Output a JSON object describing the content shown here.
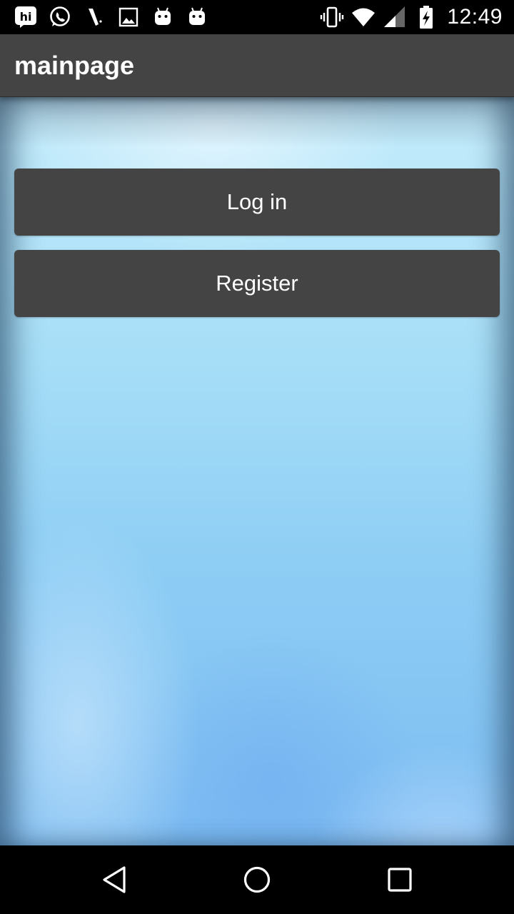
{
  "status_bar": {
    "time": "12:49",
    "left_icons": [
      "hike-icon",
      "whatsapp-icon",
      "pen-icon",
      "image-icon",
      "android-icon",
      "android-icon"
    ],
    "right_icons": [
      "vibrate-icon",
      "wifi-icon",
      "signal-icon",
      "battery-charging-icon"
    ]
  },
  "app_bar": {
    "title": "mainpage"
  },
  "main": {
    "login_label": "Log in",
    "register_label": "Register"
  },
  "nav_bar": {
    "buttons": [
      "back-icon",
      "home-icon",
      "recents-icon"
    ]
  },
  "colors": {
    "bar_gray": "#444444",
    "status_black": "#000000",
    "button_text": "#ffffff",
    "background_blue": "#8cccf4"
  }
}
